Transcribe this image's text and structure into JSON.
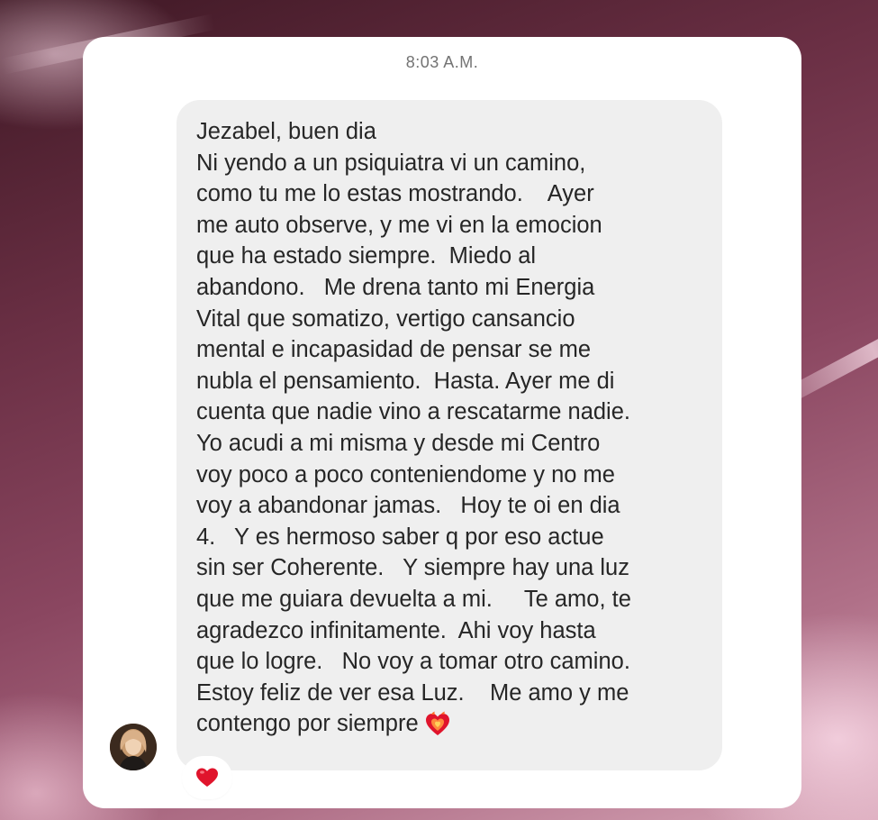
{
  "chat": {
    "timestamp": "8:03 A.M.",
    "message": {
      "lines": [
        "Jezabel, buen dia",
        "Ni yendo a un psiquiatra vi un camino,",
        "como tu me lo estas mostrando.    Ayer",
        "me auto observe, y me vi en la emocion",
        "que ha estado siempre.  Miedo al",
        "abandono.   Me drena tanto mi Energia",
        "Vital que somatizo, vertigo cansancio",
        "mental e incapasidad de pensar se me",
        "nubla el pensamiento.  Hasta. Ayer me di",
        "cuenta que nadie vino a rescatarme nadie.",
        "Yo acudi a mi misma y desde mi Centro",
        "voy poco a poco conteniendome y no me",
        "voy a abandonar jamas.   Hoy te oi en dia",
        "4.   Y es hermoso saber q por eso actue",
        "sin ser Coherente.   Y siempre hay una luz",
        "que me guiara devuelta a mi.     Te amo, te",
        "agradezco infinitamente.  Ahi voy hasta",
        "que lo logre.   No voy a tomar otro camino.",
        "Estoy feliz de ver esa Luz.    Me amo y me",
        "contengo por siempre"
      ],
      "inline_emoji": "heart-on-fire-icon"
    },
    "sender_avatar": "avatar",
    "reaction": "red-heart-icon"
  },
  "colors": {
    "bubble": "#efefef",
    "text": "#262626",
    "timestamp": "#737373",
    "heart": "#e0142c"
  }
}
